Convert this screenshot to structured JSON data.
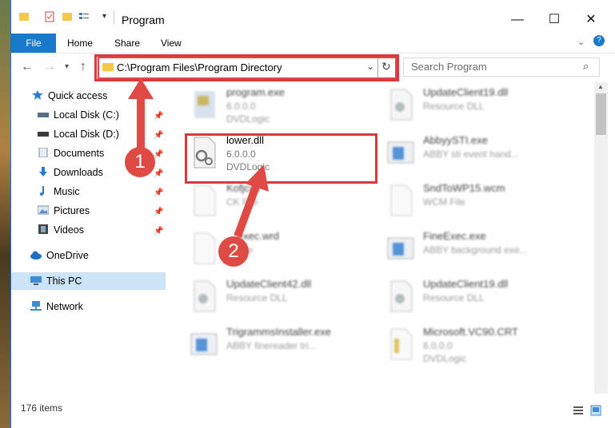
{
  "window": {
    "title": "Program"
  },
  "ribbon": {
    "file": "File",
    "tabs": [
      "Home",
      "Share",
      "View"
    ]
  },
  "address": {
    "path": "C:\\Program Files\\Program Directory",
    "search_placeholder": "Search Program"
  },
  "sidebar": {
    "items": [
      {
        "label": "Quick access",
        "icon": "star-icon"
      },
      {
        "label": "Local Disk (C:)",
        "icon": "drive-icon"
      },
      {
        "label": "Local Disk (D:)",
        "icon": "drive-icon"
      },
      {
        "label": "Documents",
        "icon": "documents-icon"
      },
      {
        "label": "Downloads",
        "icon": "download-icon"
      },
      {
        "label": "Music",
        "icon": "music-icon"
      },
      {
        "label": "Pictures",
        "icon": "pictures-icon"
      },
      {
        "label": "Videos",
        "icon": "videos-icon"
      },
      {
        "label": "OneDrive",
        "icon": "cloud-icon"
      },
      {
        "label": "This PC",
        "icon": "computer-icon"
      },
      {
        "label": "Network",
        "icon": "network-icon"
      }
    ]
  },
  "files": [
    {
      "name": "program.exe",
      "line1": "6.0.0.0",
      "line2": "DVDLogic"
    },
    {
      "name": "UpdateClient19.dll",
      "line1": "Resource DLL",
      "line2": ""
    },
    {
      "name": "lower.dll",
      "line1": "6.0.0.0",
      "line2": "DVDLogic"
    },
    {
      "name": "AbbyySTI.exe",
      "line1": "ABBY sti event hand...",
      "line2": ""
    },
    {
      "name": "Kofjcck",
      "line1": "CK File",
      "line2": ""
    },
    {
      "name": "SndToWP15.wcm",
      "line1": "WCM File",
      "line2": ""
    },
    {
      "name": "exec.wrd",
      "line1": "File",
      "line2": ""
    },
    {
      "name": "FineExec.exe",
      "line1": "ABBY background exe...",
      "line2": ""
    },
    {
      "name": "UpdateClient42.dll",
      "line1": "Resource DLL",
      "line2": ""
    },
    {
      "name": "UpdateClient19.dll",
      "line1": "Resource DLL",
      "line2": ""
    },
    {
      "name": "TrigrammsInstaller.exe",
      "line1": "ABBY finereader tri...",
      "line2": ""
    },
    {
      "name": "Microsoft.VC90.CRT",
      "line1": "6.0.0.0",
      "line2": "DVDLogic"
    }
  ],
  "status": {
    "count": "176 items"
  },
  "annotations": {
    "step1": "1",
    "step2": "2"
  },
  "colors": {
    "accent": "#1979ca",
    "highlight": "#d9383d"
  }
}
